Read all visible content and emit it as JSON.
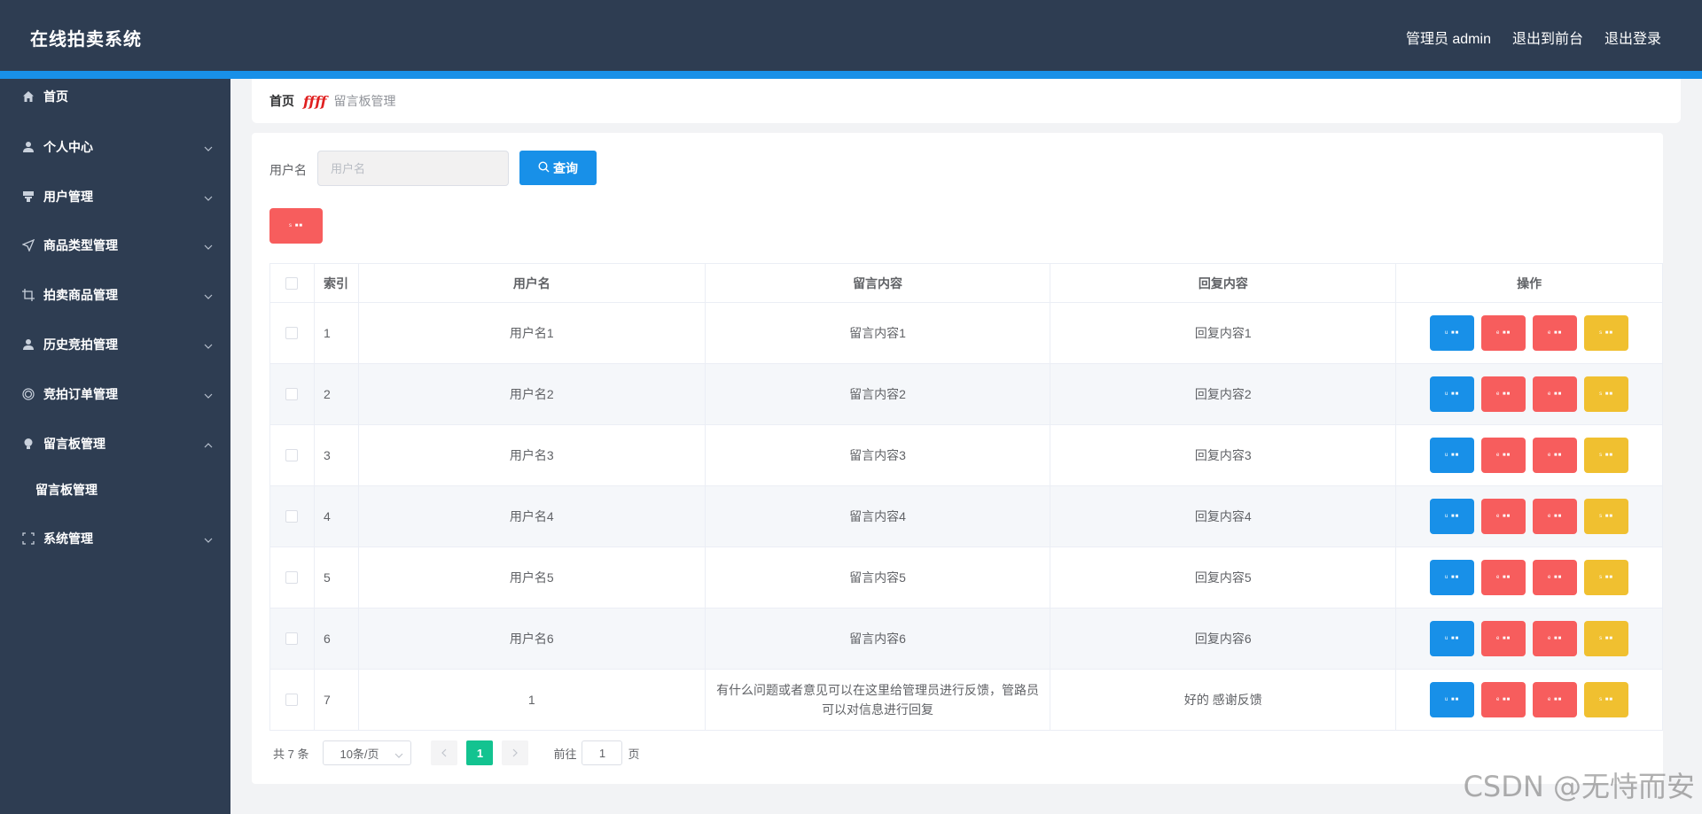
{
  "header": {
    "title": "在线拍卖系统",
    "nav": [
      "管理员 admin",
      "退出到前台",
      "退出登录"
    ]
  },
  "sidebar": {
    "items": [
      {
        "label": "首页",
        "icon": "home-icon"
      },
      {
        "label": "个人中心",
        "icon": "user-icon"
      },
      {
        "label": "用户管理",
        "icon": "stamp-icon"
      },
      {
        "label": "商品类型管理",
        "icon": "send-icon"
      },
      {
        "label": "拍卖商品管理",
        "icon": "crop-icon"
      },
      {
        "label": "历史竞拍管理",
        "icon": "user-icon"
      },
      {
        "label": "竞拍订单管理",
        "icon": "target-icon"
      },
      {
        "label": "留言板管理",
        "icon": "bulb-icon"
      },
      {
        "label": "系统管理",
        "icon": "fullscreen-icon"
      }
    ],
    "submenu": {
      "label": "留言板管理"
    }
  },
  "breadcrumb": {
    "home": "首页",
    "separator": "ffff",
    "current": "留言板管理"
  },
  "search": {
    "label": "用户名",
    "placeholder": "用户名",
    "button": "查询"
  },
  "delete_button": {
    "mini_label": "s ■■"
  },
  "table": {
    "headers": [
      "索引",
      "用户名",
      "留言内容",
      "回复内容",
      "操作"
    ],
    "rows": [
      {
        "index": "1",
        "user": "用户名1",
        "message": "留言内容1",
        "reply": "回复内容1"
      },
      {
        "index": "2",
        "user": "用户名2",
        "message": "留言内容2",
        "reply": "回复内容2"
      },
      {
        "index": "3",
        "user": "用户名3",
        "message": "留言内容3",
        "reply": "回复内容3"
      },
      {
        "index": "4",
        "user": "用户名4",
        "message": "留言内容4",
        "reply": "回复内容4"
      },
      {
        "index": "5",
        "user": "用户名5",
        "message": "留言内容5",
        "reply": "回复内容5"
      },
      {
        "index": "6",
        "user": "用户名6",
        "message": "留言内容6",
        "reply": "回复内容6"
      },
      {
        "index": "7",
        "user": "1",
        "message": "有什么问题或者意见可以在这里给管理员进行反馈，管路员可以对信息进行回复",
        "reply": "好的 感谢反馈"
      }
    ],
    "op_mini_labels": [
      "u ■■",
      "e ■■",
      "e ■■",
      "s ■■"
    ],
    "op_colors": [
      "#1890e8",
      "#f75d5d",
      "#f75d5d",
      "#f0c030"
    ]
  },
  "pagination": {
    "total": "共 7 条",
    "page_size": "10条/页",
    "current_page": "1",
    "goto_label": "前往",
    "goto_value": "1",
    "page_unit": "页"
  },
  "watermark": "CSDN @无恃而安",
  "colors": {
    "header_bg": "#2e3d52",
    "accent": "#1890e8",
    "danger": "#f75d5d",
    "warning": "#f0c030",
    "success": "#13c390"
  }
}
